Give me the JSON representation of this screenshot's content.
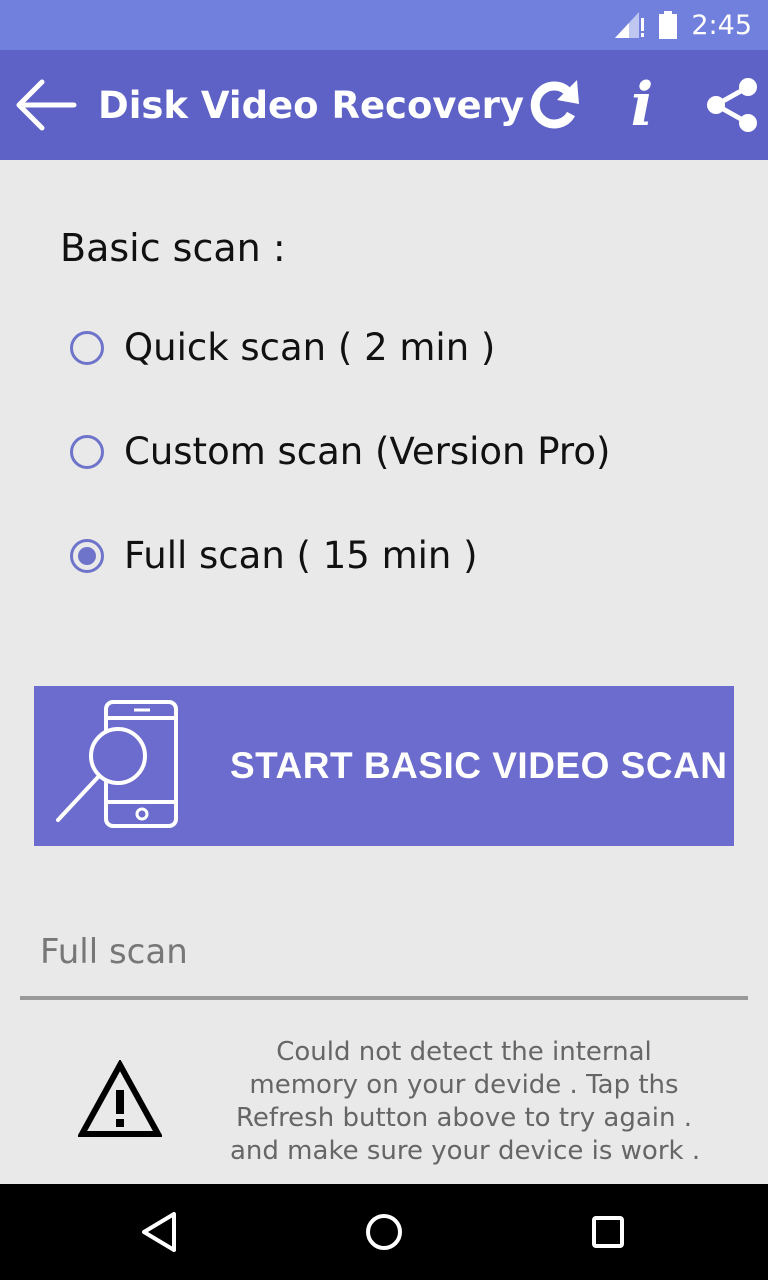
{
  "status_bar": {
    "time": "2:45"
  },
  "app_bar": {
    "title": "Disk Video Recovery"
  },
  "basic_scan": {
    "label": "Basic scan :",
    "options": [
      {
        "label": "Quick scan ( 2 min )",
        "selected": false
      },
      {
        "label": "Custom scan (Version Pro)",
        "selected": false
      },
      {
        "label": "Full scan ( 15 min )",
        "selected": true
      }
    ]
  },
  "start_button": {
    "label": "START BASIC VIDEO SCAN"
  },
  "scan_mode_field": {
    "value": "Full scan"
  },
  "warning": {
    "lines": [
      "Could not detect the internal",
      "memory on your devide . Tap ths",
      "Refresh button above to try again .",
      "and make sure your device is work ."
    ]
  },
  "colors": {
    "status_bar": "#7180dd",
    "app_bar": "#5e62c6",
    "accent": "#6e74c9",
    "button": "#6c6ccf",
    "background": "#e9e9e9"
  },
  "icons": {
    "back": "arrow-left-icon",
    "refresh": "refresh-icon",
    "info": "info-icon",
    "share": "share-icon",
    "scan": "phone-search-icon",
    "warning": "warning-icon"
  }
}
